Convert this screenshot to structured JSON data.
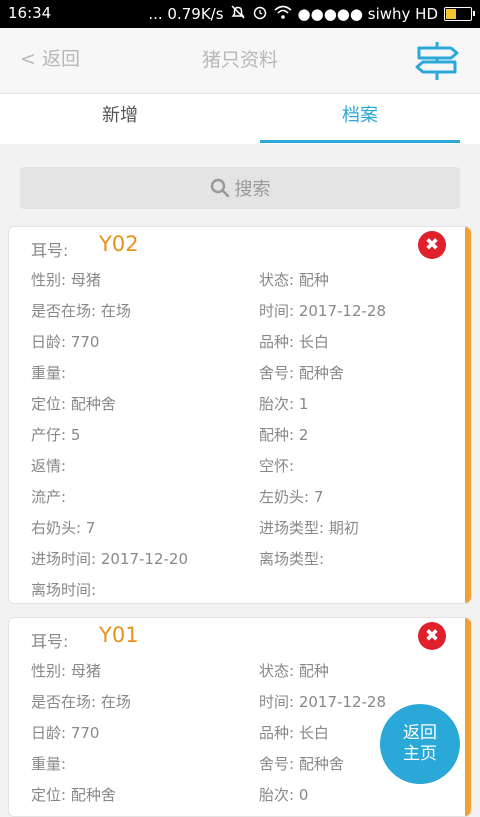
{
  "status_bar": {
    "time": "16:34",
    "speed": "... 0.79K/s",
    "carrier": "●●●●● siwhy HD",
    "icons": [
      "mute-icon",
      "alarm-icon",
      "wifi-icon",
      "battery-icon"
    ]
  },
  "navbar": {
    "back_label": "< 返回",
    "title": "猪只资料",
    "right_icon": "signpost-icon",
    "accent": "#2aa8d8"
  },
  "tabs": [
    {
      "label": "新增",
      "active": false
    },
    {
      "label": "档案",
      "active": true
    }
  ],
  "search": {
    "placeholder": "搜索"
  },
  "cards": [
    {
      "ear_label": "耳号:",
      "ear_value": "Y02",
      "fields": [
        "性别: 母猪",
        "状态: 配种",
        "是否在场: 在场",
        "时间: 2017-12-28",
        "日龄: 770",
        "品种: 长白",
        "重量:",
        "舍号: 配种舍",
        "定位: 配种舍",
        "胎次: 1",
        "产仔: 5",
        "配种: 2",
        "返情:",
        "空怀:",
        "流产:",
        "左奶头: 7",
        "右奶头: 7",
        "进场类型: 期初",
        "进场时间: 2017-12-20",
        "离场类型:",
        "离场时间:"
      ]
    },
    {
      "ear_label": "耳号:",
      "ear_value": "Y01",
      "fields": [
        "性别: 母猪",
        "状态: 配种",
        "是否在场: 在场",
        "时间: 2017-12-28",
        "日龄: 770",
        "品种: 长白",
        "重量:",
        "舍号: 配种舍",
        "定位: 配种舍",
        "胎次: 0"
      ]
    }
  ],
  "home_button": {
    "line1": "返回",
    "line2": "主页"
  },
  "colors": {
    "ear_value": "#e8911c",
    "card_bar": "#f0a133",
    "delete": "#e0202a"
  }
}
